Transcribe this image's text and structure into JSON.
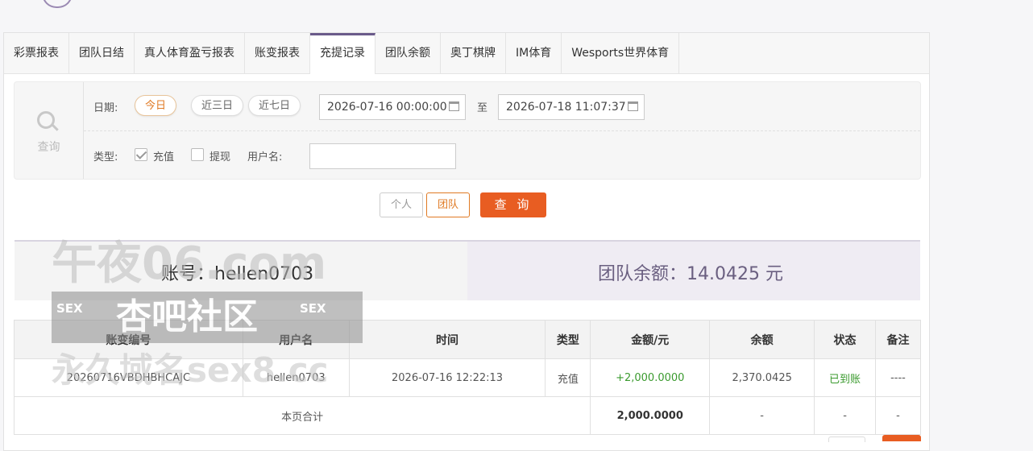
{
  "tabs": [
    "彩票报表",
    "团队日结",
    "真人体育盈亏报表",
    "账变报表",
    "充提记录",
    "团队余额",
    "奥丁棋牌",
    "IM体育",
    "Wesports世界体育"
  ],
  "active_tab": "充提记录",
  "search": {
    "side_label": "查询",
    "date_label": "日期:",
    "quick_ranges": [
      "今日",
      "近三日",
      "近七日"
    ],
    "start_date": "2026-07-16 00:00:00",
    "to_label": "至",
    "end_date": "2026-07-18 11:07:37",
    "type_label": "类型:",
    "type_deposit": "充值",
    "type_deposit_checked": true,
    "type_withdraw": "提现",
    "type_withdraw_checked": false,
    "username_label": "用户名:",
    "username_value": ""
  },
  "buttons": {
    "personal": "个人",
    "team": "团队",
    "query": "查 询"
  },
  "summary": {
    "account": "账号：hellen0703",
    "team_balance": "团队余额：14.0425 元"
  },
  "table": {
    "headers": [
      "账变编号",
      "用户名",
      "时间",
      "类型",
      "金额/元",
      "余额",
      "状态",
      "备注"
    ],
    "rows": [
      [
        "20260716VBDHBHCAJC",
        "hellen0703",
        "2026-07-16 12:22:13",
        "充值",
        "+2,000.0000",
        "2,370.0425",
        "已到账",
        "----"
      ]
    ],
    "footer": {
      "label": "本页合计",
      "amount": "2,000.0000",
      "balance": "-",
      "status": "-",
      "note": "-"
    }
  },
  "watermark": {
    "line1": "午夜06.com",
    "line2": "杏吧社区",
    "sex": "SEX",
    "line3": "永久域名sex8.cc"
  },
  "colors": {
    "accent": "#e85d22",
    "tab_active": "#6a5a8a",
    "success": "#3a9a2e"
  }
}
